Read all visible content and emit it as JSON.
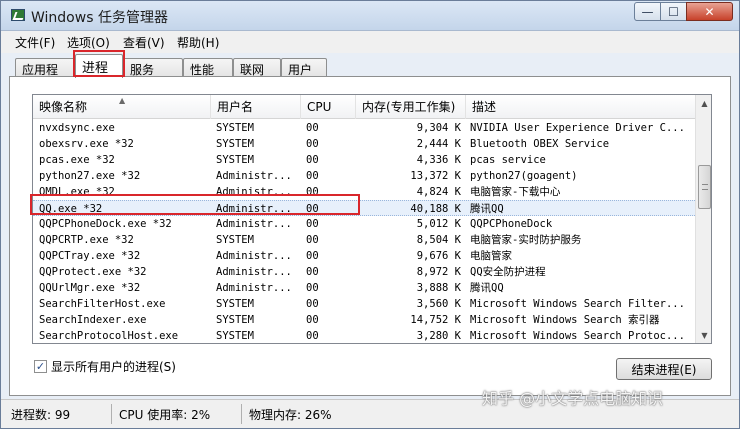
{
  "window": {
    "title": "Windows 任务管理器",
    "min_glyph": "—",
    "max_glyph": "☐",
    "close_glyph": "✕"
  },
  "menu": [
    "文件(F)",
    "选项(O)",
    "查看(V)",
    "帮助(H)"
  ],
  "tabs": [
    "应用程序",
    "进程",
    "服务",
    "性能",
    "联网",
    "用户"
  ],
  "active_tab": "进程",
  "columns": {
    "name": "映像名称",
    "user": "用户名",
    "cpu": "CPU",
    "mem": "内存(专用工作集)",
    "desc": "描述"
  },
  "processes": [
    {
      "name": "nvxdsync.exe",
      "user": "SYSTEM",
      "cpu": "00",
      "mem": "9,304 K",
      "desc": "NVIDIA User Experience Driver C..."
    },
    {
      "name": "obexsrv.exe *32",
      "user": "SYSTEM",
      "cpu": "00",
      "mem": "2,444 K",
      "desc": "Bluetooth OBEX Service"
    },
    {
      "name": "pcas.exe *32",
      "user": "SYSTEM",
      "cpu": "00",
      "mem": "4,336 K",
      "desc": "pcas service"
    },
    {
      "name": "python27.exe *32",
      "user": "Administr...",
      "cpu": "00",
      "mem": "13,372 K",
      "desc": "python27(goagent)"
    },
    {
      "name": "QMDL.exe *32",
      "user": "Administr...",
      "cpu": "00",
      "mem": "4,824 K",
      "desc": "电脑管家-下载中心"
    },
    {
      "name": "QQ.exe *32",
      "user": "Administr...",
      "cpu": "00",
      "mem": "40,188 K",
      "desc": "腾讯QQ"
    },
    {
      "name": "QQPCPhoneDock.exe *32",
      "user": "Administr...",
      "cpu": "00",
      "mem": "5,012 K",
      "desc": "QQPCPhoneDock"
    },
    {
      "name": "QQPCRTP.exe *32",
      "user": "SYSTEM",
      "cpu": "00",
      "mem": "8,504 K",
      "desc": "电脑管家-实时防护服务"
    },
    {
      "name": "QQPCTray.exe *32",
      "user": "Administr...",
      "cpu": "00",
      "mem": "9,676 K",
      "desc": "电脑管家"
    },
    {
      "name": "QQProtect.exe *32",
      "user": "Administr...",
      "cpu": "00",
      "mem": "8,972 K",
      "desc": "QQ安全防护进程"
    },
    {
      "name": "QQUrlMgr.exe *32",
      "user": "Administr...",
      "cpu": "00",
      "mem": "3,888 K",
      "desc": "腾讯QQ"
    },
    {
      "name": "SearchFilterHost.exe",
      "user": "SYSTEM",
      "cpu": "00",
      "mem": "3,560 K",
      "desc": "Microsoft Windows Search Filter..."
    },
    {
      "name": "SearchIndexer.exe",
      "user": "SYSTEM",
      "cpu": "00",
      "mem": "14,752 K",
      "desc": "Microsoft Windows Search 索引器"
    },
    {
      "name": "SearchProtocolHost.exe",
      "user": "SYSTEM",
      "cpu": "00",
      "mem": "3,280 K",
      "desc": "Microsoft Windows Search Protoc..."
    },
    {
      "name": "",
      "user": "SYSTEM",
      "cpu": "00",
      "mem": "",
      "desc": ""
    }
  ],
  "selected_process": "QQ.exe *32",
  "show_all_users_label": "显示所有用户的进程(S)",
  "show_all_users_checked": true,
  "end_process_label": "结束进程(E)",
  "status": {
    "process_count": "进程数: 99",
    "cpu_usage": "CPU 使用率: 2%",
    "physical_memory": "物理内存: 26%"
  },
  "watermark": "知乎 @小文学点电脑知识",
  "colors": {
    "highlight_box": "#d9262b",
    "selected_row": "#e7f0fb",
    "close_button": "#c7412a"
  }
}
